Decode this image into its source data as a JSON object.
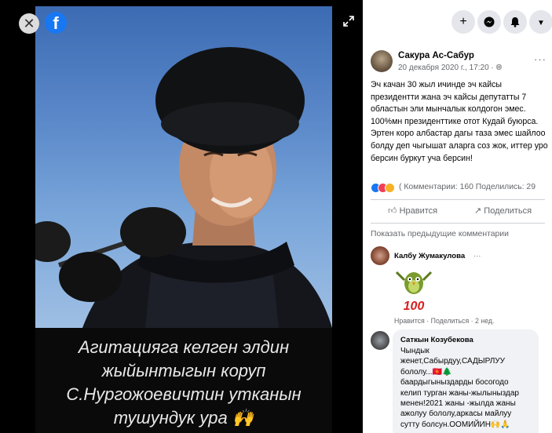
{
  "viewer": {
    "caption_lines": [
      "Агитацияга келген элдин",
      "жыйынтыгын коруп",
      "С.Нургожоевичтин утканын",
      "тушундук ура 🙌"
    ]
  },
  "topbar": {
    "icons": [
      "plus-icon",
      "messenger-icon",
      "bell-icon",
      "chevron-down-icon"
    ]
  },
  "post": {
    "author": "Сакура Ас-Сабур",
    "date": "20 декабря 2020 г., 17:20 · ",
    "privacy_icon": "globe-icon",
    "more": "···",
    "text": "Эч качан 30 жыл ичинде эч кайсы президентти жана эч кайсы депутатты 7 областын эли мынчалык колдогон эмес. 100%мн президенттике отот Кудай буюрса. Эртен коро албастар дагы таза эмес шайлоо болду деп чыгышат аларга соз жок, иттер уро берсин буркут уча берсин!",
    "stats": "( Комментарии: 160  Поделились: 29",
    "like_label": "Нравится",
    "share_label": "Поделиться",
    "prev_comments": "Показать предыдущие комментарии"
  },
  "comments": [
    {
      "name": "Калбу Жумакулова",
      "more": "···",
      "meta": "Нравится · Поделиться · 2 нед."
    },
    {
      "name": "Саткын Козубекова",
      "lines": [
        "Чындык",
        "женет,Сабырдуу,САДЫРЛУУ",
        "бололу...🇰🇬🌲",
        "баардыгыныздарды босогодо",
        "келип турган жаны-жылыныздар",
        "менен!2021 жаны -жылда жаны",
        "ажолуу бололу,аркасы майлуу",
        "сутту болсун.ООМИЙИН🙌🙏"
      ]
    }
  ],
  "colors": {
    "facebook_blue": "#1877f2",
    "panel_bg": "#ffffff",
    "viewer_bg": "#000000"
  }
}
